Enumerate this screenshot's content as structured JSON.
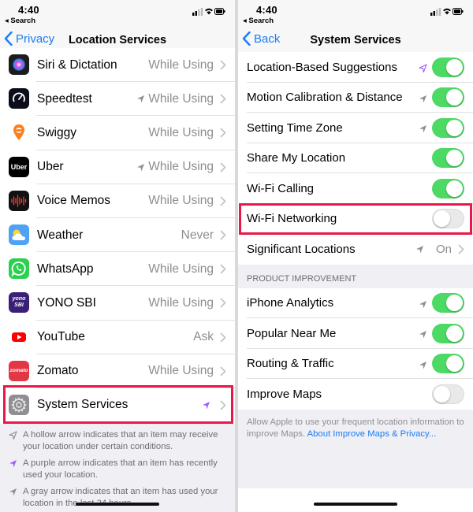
{
  "left": {
    "status": {
      "time": "4:40",
      "back_app": "◂ Search"
    },
    "nav": {
      "back_label": "Privacy",
      "title": "Location Services"
    },
    "rows": [
      {
        "name": "Siri & Dictation",
        "value": "While Using",
        "arrow": "none",
        "icon": "siri-icon",
        "icon_color": "#1c1c1e"
      },
      {
        "name": "Speedtest",
        "value": "While Using",
        "arrow": "gray",
        "icon": "speedtest-icon",
        "icon_color": "#0b0d1c"
      },
      {
        "name": "Swiggy",
        "value": "While Using",
        "arrow": "none",
        "icon": "swiggy-icon",
        "icon_color": "#ffffff"
      },
      {
        "name": "Uber",
        "value": "While Using",
        "arrow": "gray",
        "icon": "uber-icon",
        "icon_color": "#000000",
        "icon_text": "Uber"
      },
      {
        "name": "Voice Memos",
        "value": "While Using",
        "arrow": "none",
        "icon": "voice-memos-icon",
        "icon_color": "#111111"
      },
      {
        "name": "Weather",
        "value": "Never",
        "arrow": "none",
        "icon": "weather-icon",
        "icon_color": "#4ea3f5"
      },
      {
        "name": "WhatsApp",
        "value": "While Using",
        "arrow": "none",
        "icon": "whatsapp-icon",
        "icon_color": "#2bd14e"
      },
      {
        "name": "YONO SBI",
        "value": "While Using",
        "arrow": "none",
        "icon": "yono-sbi-icon",
        "icon_color": "#3a1f78",
        "icon_text": "yono SBI"
      },
      {
        "name": "YouTube",
        "value": "Ask",
        "arrow": "none",
        "icon": "youtube-icon",
        "icon_color": "#ffffff"
      },
      {
        "name": "Zomato",
        "value": "While Using",
        "arrow": "none",
        "icon": "zomato-icon",
        "icon_color": "#e23744",
        "icon_text": "zomato"
      },
      {
        "name": "System Services",
        "value": "",
        "arrow": "purple",
        "icon": "gear-icon",
        "icon_color": "#8e8e93"
      }
    ],
    "legend": [
      {
        "text": "A hollow arrow indicates that an item may receive your location under certain conditions.",
        "style": "hollow"
      },
      {
        "text": "A purple arrow indicates that an item has recently used your location.",
        "style": "purple"
      },
      {
        "text": "A gray arrow indicates that an item has used your location in the last 24 hours.",
        "style": "gray"
      }
    ]
  },
  "right": {
    "status": {
      "time": "4:40",
      "back_app": "◂ Search"
    },
    "nav": {
      "back_label": "Back",
      "title": "System Services"
    },
    "group1": [
      {
        "label": "Location-Based Suggestions",
        "arrow": "hollow-purple",
        "on": true
      },
      {
        "label": "Motion Calibration & Distance",
        "arrow": "gray",
        "on": true
      },
      {
        "label": "Setting Time Zone",
        "arrow": "gray",
        "on": true
      },
      {
        "label": "Share My Location",
        "arrow": "none",
        "on": true
      },
      {
        "label": "Wi-Fi Calling",
        "arrow": "none",
        "on": true
      },
      {
        "label": "Wi-Fi Networking",
        "arrow": "none",
        "on": false
      },
      {
        "label": "Significant Locations",
        "arrow": "gray",
        "value": "On"
      }
    ],
    "section_header": "PRODUCT IMPROVEMENT",
    "group2": [
      {
        "label": "iPhone Analytics",
        "arrow": "gray",
        "on": true
      },
      {
        "label": "Popular Near Me",
        "arrow": "gray",
        "on": true
      },
      {
        "label": "Routing & Traffic",
        "arrow": "gray",
        "on": true
      },
      {
        "label": "Improve Maps",
        "arrow": "none",
        "on": false
      }
    ],
    "footer": {
      "text": "Allow Apple to use your frequent location information to improve Maps.",
      "link": "About Improve Maps & Privacy..."
    }
  },
  "colors": {
    "accent": "#1a7cf5",
    "toggle_on": "#4cd964",
    "highlight": "#e8194a",
    "purple_arrow": "#a259ff",
    "gray_arrow": "#8e8e93"
  }
}
